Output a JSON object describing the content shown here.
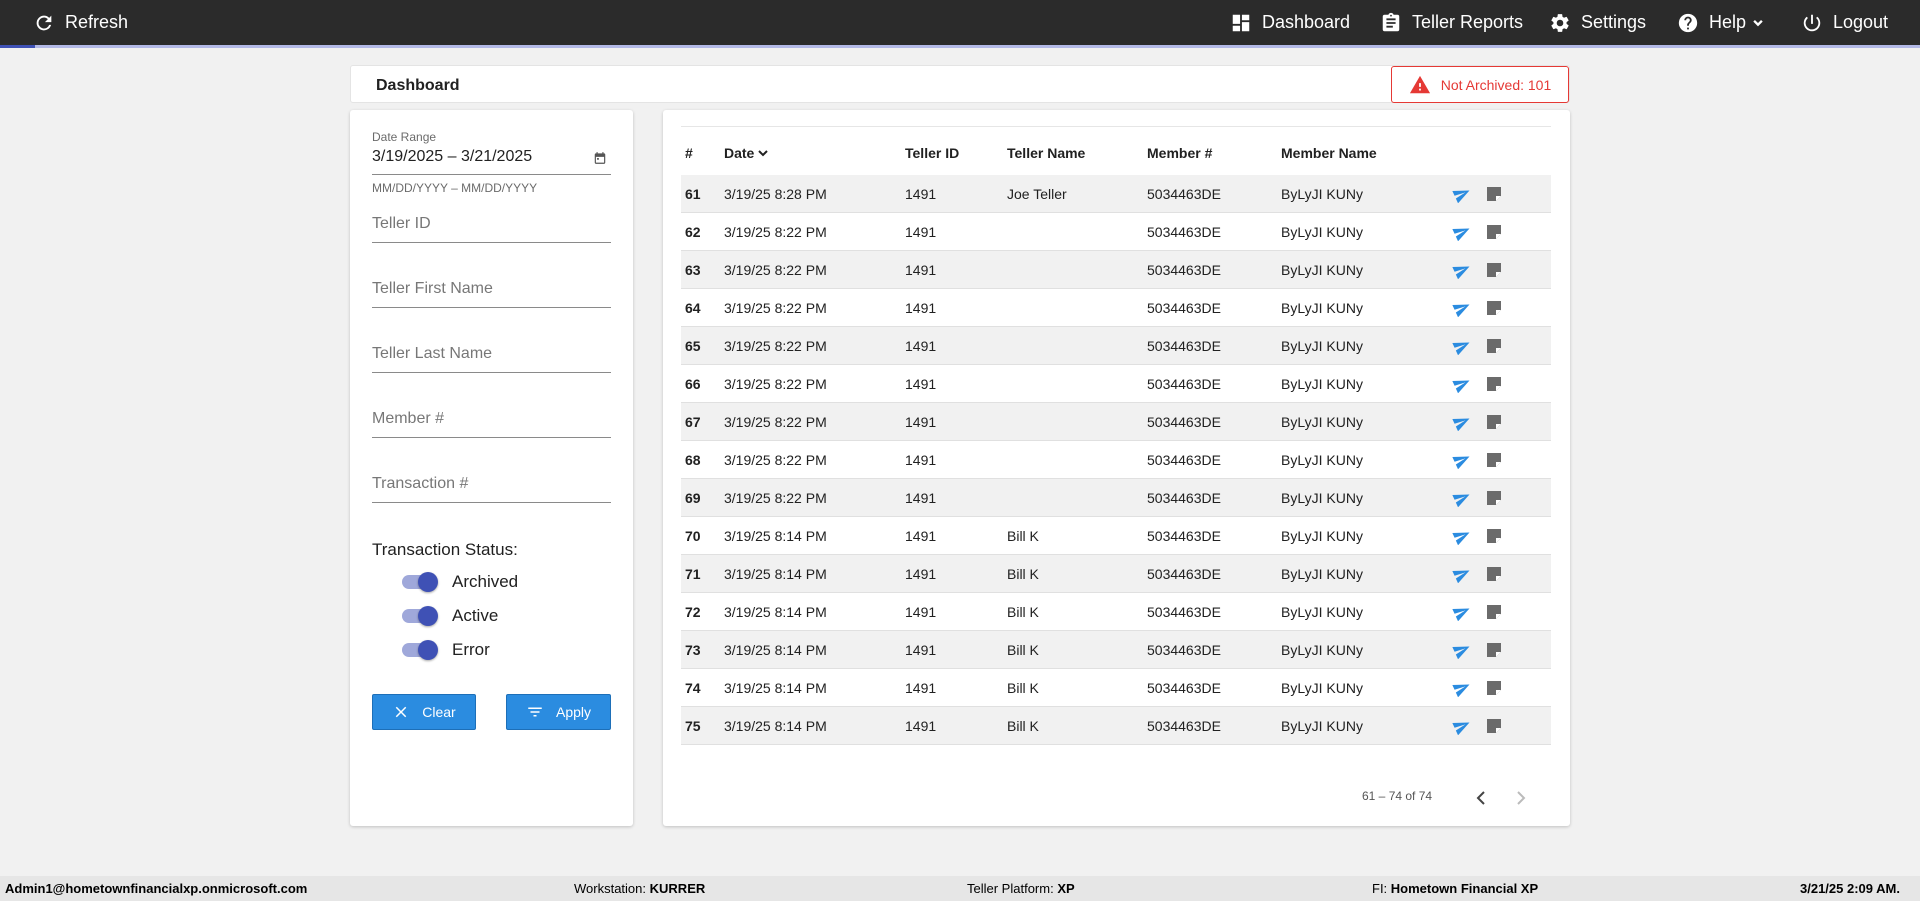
{
  "topbar": {
    "refresh": "Refresh",
    "nav": [
      {
        "label": "Dashboard",
        "icon": "dashboard-icon"
      },
      {
        "label": "Teller Reports",
        "icon": "clipboard-icon"
      },
      {
        "label": "Settings",
        "icon": "gear-icon"
      },
      {
        "label": "Help",
        "icon": "help-icon"
      },
      {
        "label": "Logout",
        "icon": "power-icon"
      }
    ]
  },
  "dashboard": {
    "title": "Dashboard",
    "alert_label": "Not Archived: 101",
    "alert_color": "#e53935"
  },
  "filters": {
    "date_range_label": "Date Range",
    "date_range_value": "3/19/2025 – 3/21/2025",
    "date_range_hint": "MM/DD/YYYY – MM/DD/YYYY",
    "teller_id_placeholder": "Teller ID",
    "teller_first_name_placeholder": "Teller First Name",
    "teller_last_name_placeholder": "Teller Last Name",
    "member_number_placeholder": "Member #",
    "transaction_number_placeholder": "Transaction #",
    "status_label": "Transaction Status:",
    "statuses": [
      {
        "label": "Archived",
        "on": true
      },
      {
        "label": "Active",
        "on": true
      },
      {
        "label": "Error",
        "on": true
      }
    ],
    "clear_label": "Clear",
    "apply_label": "Apply",
    "accent_color": "#3f51b5",
    "button_color": "#2b8ce0"
  },
  "table": {
    "headers": {
      "num": "#",
      "date": "Date",
      "teller_id": "Teller ID",
      "teller_name": "Teller Name",
      "member_number": "Member #",
      "member_name": "Member Name"
    },
    "sort_indicator": "chevron-down-icon",
    "rows": [
      {
        "num": "61",
        "date": "3/19/25 8:28 PM",
        "teller_id": "1491",
        "teller_name": "Joe Teller",
        "member_number": "5034463DE",
        "member_name": "ByLyJI KUNy"
      },
      {
        "num": "62",
        "date": "3/19/25 8:22 PM",
        "teller_id": "1491",
        "teller_name": "",
        "member_number": "5034463DE",
        "member_name": "ByLyJI KUNy"
      },
      {
        "num": "63",
        "date": "3/19/25 8:22 PM",
        "teller_id": "1491",
        "teller_name": "",
        "member_number": "5034463DE",
        "member_name": "ByLyJI KUNy"
      },
      {
        "num": "64",
        "date": "3/19/25 8:22 PM",
        "teller_id": "1491",
        "teller_name": "",
        "member_number": "5034463DE",
        "member_name": "ByLyJI KUNy"
      },
      {
        "num": "65",
        "date": "3/19/25 8:22 PM",
        "teller_id": "1491",
        "teller_name": "",
        "member_number": "5034463DE",
        "member_name": "ByLyJI KUNy"
      },
      {
        "num": "66",
        "date": "3/19/25 8:22 PM",
        "teller_id": "1491",
        "teller_name": "",
        "member_number": "5034463DE",
        "member_name": "ByLyJI KUNy"
      },
      {
        "num": "67",
        "date": "3/19/25 8:22 PM",
        "teller_id": "1491",
        "teller_name": "",
        "member_number": "5034463DE",
        "member_name": "ByLyJI KUNy"
      },
      {
        "num": "68",
        "date": "3/19/25 8:22 PM",
        "teller_id": "1491",
        "teller_name": "",
        "member_number": "5034463DE",
        "member_name": "ByLyJI KUNy"
      },
      {
        "num": "69",
        "date": "3/19/25 8:22 PM",
        "teller_id": "1491",
        "teller_name": "",
        "member_number": "5034463DE",
        "member_name": "ByLyJI KUNy"
      },
      {
        "num": "70",
        "date": "3/19/25 8:14 PM",
        "teller_id": "1491",
        "teller_name": "Bill K",
        "member_number": "5034463DE",
        "member_name": "ByLyJI KUNy"
      },
      {
        "num": "71",
        "date": "3/19/25 8:14 PM",
        "teller_id": "1491",
        "teller_name": "Bill K",
        "member_number": "5034463DE",
        "member_name": "ByLyJI KUNy"
      },
      {
        "num": "72",
        "date": "3/19/25 8:14 PM",
        "teller_id": "1491",
        "teller_name": "Bill K",
        "member_number": "5034463DE",
        "member_name": "ByLyJI KUNy"
      },
      {
        "num": "73",
        "date": "3/19/25 8:14 PM",
        "teller_id": "1491",
        "teller_name": "Bill K",
        "member_number": "5034463DE",
        "member_name": "ByLyJI KUNy"
      },
      {
        "num": "74",
        "date": "3/19/25 8:14 PM",
        "teller_id": "1491",
        "teller_name": "Bill K",
        "member_number": "5034463DE",
        "member_name": "ByLyJI KUNy"
      },
      {
        "num": "75",
        "date": "3/19/25 8:14 PM",
        "teller_id": "1491",
        "teller_name": "Bill K",
        "member_number": "5034463DE",
        "member_name": "ByLyJI KUNy"
      }
    ],
    "row_actions": [
      "send-icon",
      "note-icon"
    ],
    "send_icon_color": "#2b8ce0",
    "note_icon_color": "#6b6b6b",
    "pagination_text": "61 – 74 of 74"
  },
  "footer": {
    "user": "Admin1@hometownfinancialxp.onmicrosoft.com",
    "workstation_label": "Workstation:",
    "workstation_value": "KURRER",
    "platform_label": "Teller Platform:",
    "platform_value": "XP",
    "fi_label": "FI:",
    "fi_value": "Hometown Financial XP",
    "datetime": "3/21/25 2:09 AM."
  }
}
